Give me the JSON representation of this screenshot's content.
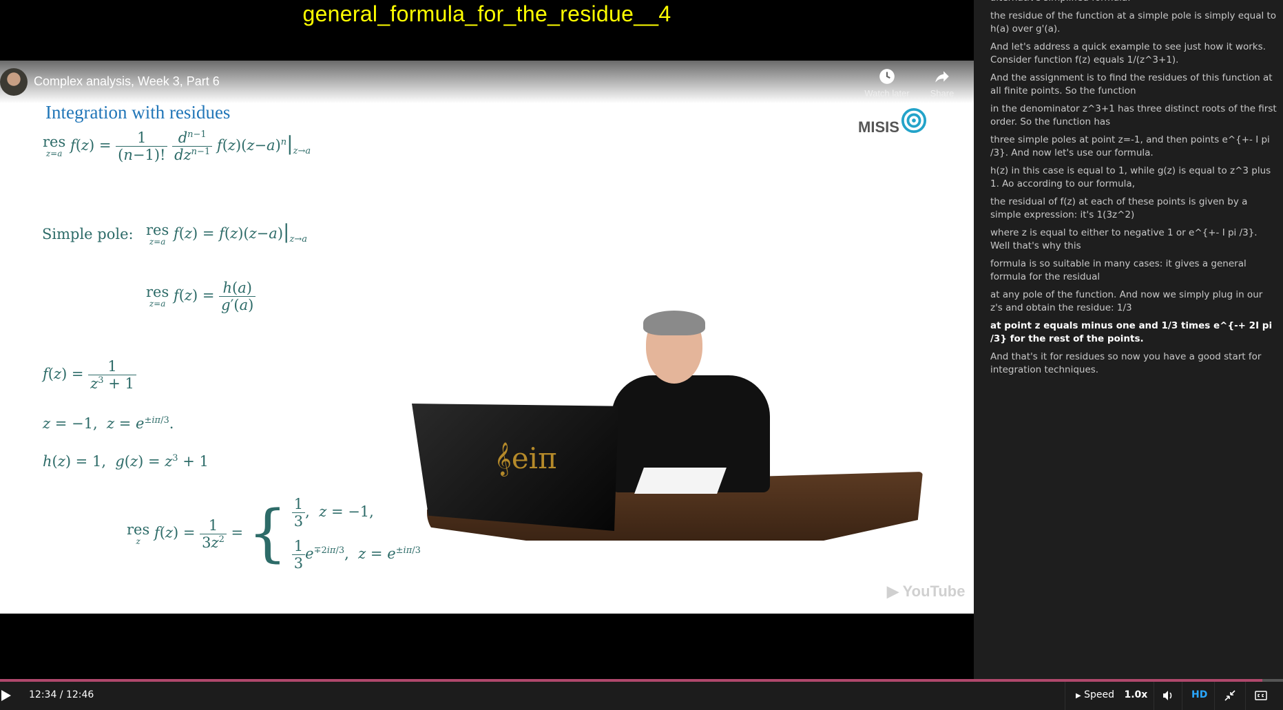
{
  "top_title": "general_formula_for_the_residue__4",
  "video": {
    "title": "Complex analysis, Week 3, Part 6",
    "watch_later_label": "Watch later",
    "share_label": "Share",
    "slide_heading": "Integration with residues",
    "logo_text": "MISIS",
    "watermark": "YouTube",
    "laptop_logo": "𝄞eiπ",
    "math": {
      "res_general": "res f(z) = 1/(n−1)! · dⁿ⁻¹/dzⁿ⁻¹ f(z)(z−a)ⁿ |z→a",
      "simple_pole_label": "Simple pole:",
      "simple_pole": "res f(z) = f(z)(z−a) |z→a",
      "h_over_g": "res f(z) = h(a)/g′(a)",
      "f_def": "f(z) = 1/(z³ + 1)",
      "poles": "z = −1,  z = e^{±iπ/3}.",
      "hg": "h(z) = 1,  g(z) = z³ + 1",
      "result": "res f(z) = 1/(3z²) = { 1/3, z = −1,  1/3 e^{∓2iπ/3}, z = e^{±iπ/3}"
    }
  },
  "transcript": {
    "cues": [
      {
        "text": "alternative simplified formula:",
        "state": "partial"
      },
      {
        "text": "the residue of the function at a simple pole is simply equal to h(a) over g'(a).",
        "state": "normal"
      },
      {
        "text": "And let's address a quick example to see just how it works. Consider function f(z) equals 1/(z^3+1).",
        "state": "normal"
      },
      {
        "text": "And the assignment is to find the residues of this function at all finite points. So the function",
        "state": "normal"
      },
      {
        "text": "in the denominator z^3+1 has three distinct roots of the first order. So the function has",
        "state": "normal"
      },
      {
        "text": "three simple poles at point z=-1, and then points e^{+- I pi /3}. And now let's use our formula.",
        "state": "normal"
      },
      {
        "text": "h(z) in this case is equal to 1, while g(z) is equal to z^3 plus 1. Ao according to our formula,",
        "state": "normal"
      },
      {
        "text": "the residual of f(z) at each of these points is given by a simple expression: it's 1(3z^2)",
        "state": "normal"
      },
      {
        "text": "where z is equal to either to negative 1 or e^{+- I pi /3}. Well that's why this",
        "state": "normal"
      },
      {
        "text": "formula is so suitable in many cases: it gives a general formula for the residual",
        "state": "normal"
      },
      {
        "text": "at any pole of the function. And now we simply plug in our z's and obtain the residue: 1/3",
        "state": "normal"
      },
      {
        "text": "at point z equals minus one and 1/3 times e^{-+ 2I pi /3} for the rest of the points.",
        "state": "active"
      },
      {
        "text": "And that's it for residues so now you have a good start for integration techniques.",
        "state": "normal"
      }
    ]
  },
  "controls": {
    "time": "12:34 / 12:46",
    "progress": 0.984,
    "speed_label": "Speed",
    "speed_value": "1.0x",
    "hd_label": "HD",
    "accent": "#b0486c"
  }
}
